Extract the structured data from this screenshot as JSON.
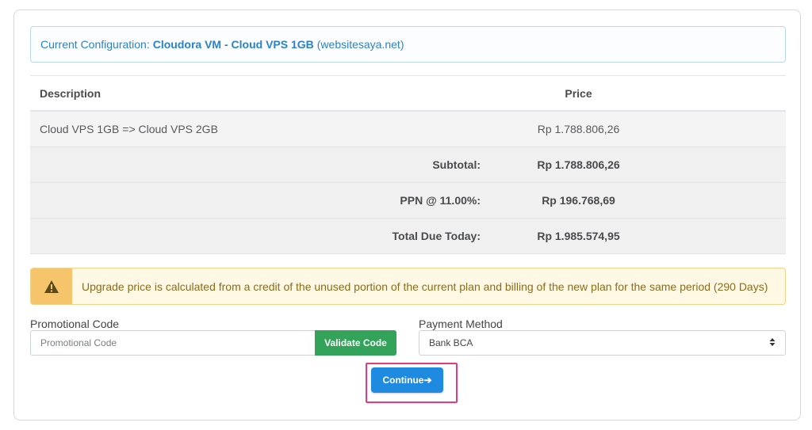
{
  "config": {
    "prefix": "Current Configuration:",
    "product": "Cloudora VM - Cloud VPS 1GB",
    "domain": "(websitesaya.net)"
  },
  "table": {
    "headers": {
      "description": "Description",
      "price": "Price"
    },
    "item": {
      "description": "Cloud VPS 1GB => Cloud VPS 2GB",
      "price": "Rp 1.788.806,26"
    },
    "subtotal": {
      "label": "Subtotal:",
      "value": "Rp 1.788.806,26"
    },
    "tax": {
      "label": "PPN @ 11.00%:",
      "value": "Rp 196.768,69"
    },
    "total": {
      "label": "Total Due Today:",
      "value": "Rp 1.985.574,95"
    }
  },
  "alert": {
    "icon": "warning-icon",
    "text": "Upgrade price is calculated from a credit of the unused portion of the current plan and billing of the new plan for the same period (290 Days)"
  },
  "promo": {
    "label": "Promotional Code",
    "placeholder": "Promotional Code",
    "value": "",
    "button": "Validate Code"
  },
  "payment": {
    "label": "Payment Method",
    "selected": "Bank BCA"
  },
  "continue": {
    "label": "Continue"
  },
  "colors": {
    "accent_blue": "#1e8ae0",
    "success_green": "#34a35a",
    "warning": "#f6c46a",
    "highlight": "#e53b7a"
  }
}
